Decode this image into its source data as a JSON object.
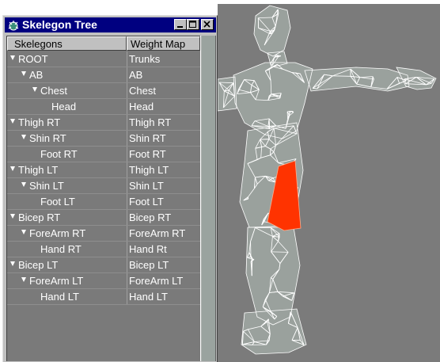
{
  "window": {
    "title": "Skelegon Tree",
    "icon": "skelegon-app-icon",
    "controls": [
      "minimize-icon",
      "maximize-icon",
      "close-icon"
    ]
  },
  "columns": {
    "skelegons": "Skelegons",
    "weight_map": "Weight Map"
  },
  "rows": [
    {
      "name": "ROOT",
      "weight": "Trunks",
      "expandable": true
    },
    {
      "name": "AB",
      "weight": "AB",
      "expandable": true
    },
    {
      "name": "Chest",
      "weight": "Chest",
      "expandable": true
    },
    {
      "name": "Head",
      "weight": "Head",
      "expandable": false
    },
    {
      "name": "Thigh RT",
      "weight": "Thigh RT",
      "expandable": true
    },
    {
      "name": "Shin RT",
      "weight": "Shin RT",
      "expandable": true
    },
    {
      "name": "Foot RT",
      "weight": "Foot RT",
      "expandable": false
    },
    {
      "name": "Thigh LT",
      "weight": "Thigh LT",
      "expandable": true
    },
    {
      "name": "Shin LT",
      "weight": "Shin LT",
      "expandable": true
    },
    {
      "name": "Foot LT",
      "weight": "Foot LT",
      "expandable": false
    },
    {
      "name": "Bicep RT",
      "weight": "Bicep RT",
      "expandable": true
    },
    {
      "name": "ForeArm RT",
      "weight": "ForeArm RT",
      "expandable": true
    },
    {
      "name": "Hand RT",
      "weight": "Hand Rt",
      "expandable": false
    },
    {
      "name": "Bicep LT",
      "weight": "Bicep LT",
      "expandable": true
    },
    {
      "name": "ForeArm LT",
      "weight": "ForeArm LT",
      "expandable": true
    },
    {
      "name": "Hand LT",
      "weight": "Hand LT",
      "expandable": false
    }
  ],
  "colors": {
    "titlebar": "#000080",
    "list_bg": "#7a7a7a",
    "viewport_bg": "#7b7b7b",
    "mesh": "#ffffff",
    "highlight": "#ff3300"
  }
}
